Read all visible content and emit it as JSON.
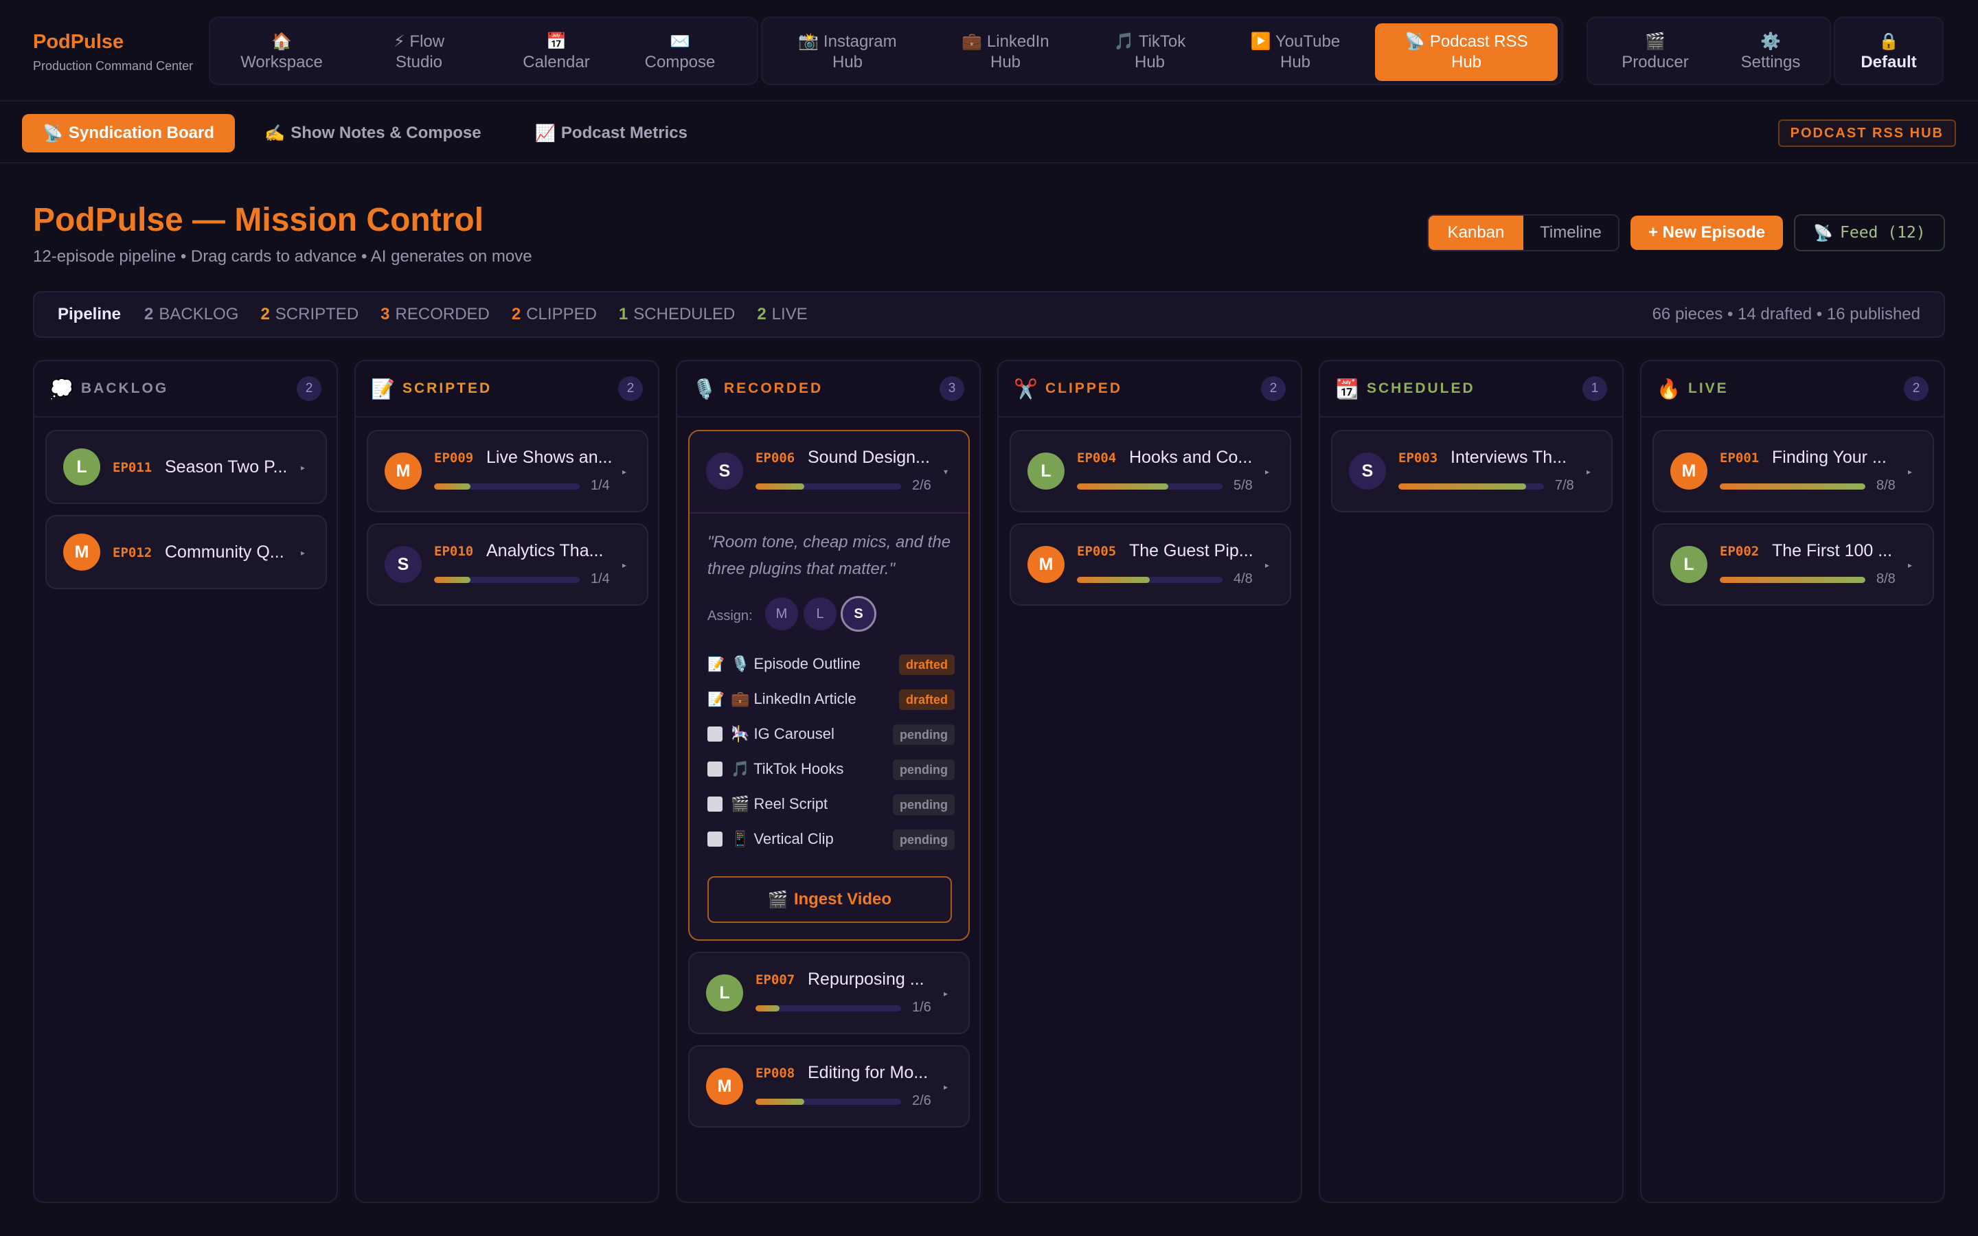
{
  "brand": {
    "name": "PodPulse",
    "subtitle": "Production Command Center"
  },
  "nav": {
    "group1": [
      {
        "icon": "🏠",
        "label1": "",
        "label2": "Workspace"
      },
      {
        "icon": "⚡",
        "label1": "Flow",
        "label2": "Studio"
      },
      {
        "icon": "📅",
        "label1": "",
        "label2": "Calendar"
      },
      {
        "icon": "✉️",
        "label1": "",
        "label2": "Compose"
      }
    ],
    "group2": [
      {
        "icon": "📸",
        "label1": "Instagram",
        "label2": "Hub"
      },
      {
        "icon": "💼",
        "label1": "LinkedIn",
        "label2": "Hub"
      },
      {
        "icon": "🎵",
        "label1": "TikTok",
        "label2": "Hub"
      },
      {
        "icon": "▶️",
        "label1": "YouTube",
        "label2": "Hub"
      },
      {
        "icon": "📡",
        "label1": "Podcast RSS",
        "label2": "Hub",
        "active": true
      }
    ],
    "group3": [
      {
        "icon": "🎬",
        "label1": "",
        "label2": "Producer"
      },
      {
        "icon": "⚙️",
        "label1": "",
        "label2": "Settings"
      }
    ],
    "group4": [
      {
        "icon": "🔒",
        "label1": "",
        "label2": "Default"
      }
    ]
  },
  "subtabs": [
    {
      "icon": "📡",
      "label": "Syndication Board",
      "active": true
    },
    {
      "icon": "✍️",
      "label": "Show Notes & Compose"
    },
    {
      "icon": "📈",
      "label": "Podcast Metrics"
    }
  ],
  "hub_badge": "PODCAST RSS HUB",
  "header": {
    "title": "PodPulse — Mission Control",
    "subtitle": "12-episode pipeline • Drag cards to advance • AI generates on move",
    "view_kanban": "Kanban",
    "view_timeline": "Timeline",
    "new_episode": "+ New Episode",
    "feed_icon": "📡",
    "feed_label": "Feed (12)"
  },
  "pipeline": {
    "title": "Pipeline",
    "stats": [
      {
        "count": "2",
        "label": "BACKLOG",
        "color": "#8f88a3"
      },
      {
        "count": "2",
        "label": "SCRIPTED",
        "color": "#e8942a"
      },
      {
        "count": "3",
        "label": "RECORDED",
        "color": "#f07a22"
      },
      {
        "count": "2",
        "label": "CLIPPED",
        "color": "#f07a22"
      },
      {
        "count": "1",
        "label": "SCHEDULED",
        "color": "#8fb05a"
      },
      {
        "count": "2",
        "label": "LIVE",
        "color": "#8fb05a"
      }
    ],
    "summary": "66 pieces • 14 drafted • 16 published"
  },
  "columns": [
    {
      "icon": "💭",
      "title": "BACKLOG",
      "count": "2",
      "color": "#8f88a3"
    },
    {
      "icon": "📝",
      "title": "SCRIPTED",
      "count": "2",
      "color": "#e8942a"
    },
    {
      "icon": "🎙️",
      "title": "RECORDED",
      "count": "3",
      "color": "#f07a22"
    },
    {
      "icon": "✂️",
      "title": "CLIPPED",
      "count": "2",
      "color": "#f07a22"
    },
    {
      "icon": "📆",
      "title": "SCHEDULED",
      "count": "1",
      "color": "#8fb05a"
    },
    {
      "icon": "🔥",
      "title": "LIVE",
      "count": "2",
      "color": "#8fb05a"
    }
  ],
  "cards": {
    "ep011": {
      "avatar": "L",
      "code": "EP011",
      "title": "Season Two P..."
    },
    "ep012": {
      "avatar": "M",
      "code": "EP012",
      "title": "Community Q..."
    },
    "ep009": {
      "avatar": "M",
      "code": "EP009",
      "title": "Live Shows an...",
      "progress_text": "1/4",
      "progress": 0.25
    },
    "ep010": {
      "avatar": "S",
      "code": "EP010",
      "title": "Analytics Tha...",
      "progress_text": "1/4",
      "progress": 0.25
    },
    "ep006": {
      "avatar": "S",
      "code": "EP006",
      "title": "Sound Design...",
      "progress_text": "2/6",
      "progress": 0.333
    },
    "ep007": {
      "avatar": "L",
      "code": "EP007",
      "title": "Repurposing ...",
      "progress_text": "1/6",
      "progress": 0.167
    },
    "ep008": {
      "avatar": "M",
      "code": "EP008",
      "title": "Editing for Mo...",
      "progress_text": "2/6",
      "progress": 0.333
    },
    "ep004": {
      "avatar": "L",
      "code": "EP004",
      "title": "Hooks and Co...",
      "progress_text": "5/8",
      "progress": 0.625
    },
    "ep005": {
      "avatar": "M",
      "code": "EP005",
      "title": "The Guest Pip...",
      "progress_text": "4/8",
      "progress": 0.5
    },
    "ep003": {
      "avatar": "S",
      "code": "EP003",
      "title": "Interviews Th...",
      "progress_text": "7/8",
      "progress": 0.875
    },
    "ep001": {
      "avatar": "M",
      "code": "EP001",
      "title": "Finding Your ...",
      "progress_text": "8/8",
      "progress": 1.0
    },
    "ep002": {
      "avatar": "L",
      "code": "EP002",
      "title": "The First 100 ...",
      "progress_text": "8/8",
      "progress": 1.0
    }
  },
  "expanded": {
    "quote": "\"Room tone, cheap mics, and the three plugins that matter.\"",
    "assign_label": "Assign:",
    "assignees": [
      "M",
      "L",
      "S"
    ],
    "tasks": [
      {
        "mark": "📝",
        "icon": "🎙️",
        "label": "Episode Outline",
        "status": "drafted"
      },
      {
        "mark": "📝",
        "icon": "💼",
        "label": "LinkedIn Article",
        "status": "drafted"
      },
      {
        "mark": "",
        "icon": "🎠",
        "label": "IG Carousel",
        "status": "pending"
      },
      {
        "mark": "",
        "icon": "🎵",
        "label": "TikTok Hooks",
        "status": "pending"
      },
      {
        "mark": "",
        "icon": "🎬",
        "label": "Reel Script",
        "status": "pending"
      },
      {
        "mark": "",
        "icon": "📱",
        "label": "Vertical Clip",
        "status": "pending"
      }
    ],
    "ingest_icon": "🎬",
    "ingest_label": "Ingest Video"
  }
}
